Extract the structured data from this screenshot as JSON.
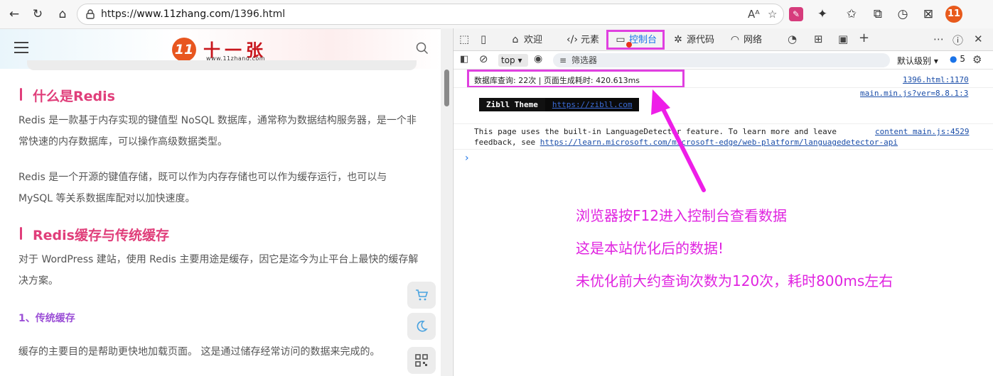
{
  "browser": {
    "url_prefix": "https://",
    "url_host": "www.11zhang.com",
    "url_path": "/1396.html",
    "read_aloud": "Aᴬ",
    "avatar_text": "11"
  },
  "site": {
    "logo_mark": "11",
    "logo_name": "十一张",
    "logo_sub": "www.11zhang.com"
  },
  "article": {
    "h2_1": "什么是Redis",
    "p1": "Redis 是一款基于内存实现的键值型 NoSQL 数据库，通常称为数据结构服务器，是一个非常快速的内存数据库，可以操作高级数据类型。",
    "p2": "Redis 是一个开源的键值存储，既可以作为内存存储也可以作为缓存运行，也可以与 MySQL 等关系数据库配对以加快速度。",
    "h2_2": "Redis缓存与传统缓存",
    "p3": "对于 WordPress 建站，使用 Redis 主要用途是缓存，因它是迄今为止平台上最快的缓存解决方案。",
    "h3_1": "1、传统缓存",
    "p4": "缓存的主要目的是帮助更快地加载页面。 这是通过储存经常访问的数据来完成的。"
  },
  "devtools": {
    "tabs": [
      {
        "label": "欢迎",
        "icon": "home-icon"
      },
      {
        "label": "元素",
        "icon": "code-icon"
      },
      {
        "label": "控制台",
        "icon": "console-icon"
      },
      {
        "label": "源代码",
        "icon": "bug-icon"
      },
      {
        "label": "网络",
        "icon": "wifi-icon"
      }
    ],
    "context": "top",
    "filter_placeholder": "筛选器",
    "level": "默认级别",
    "issues_count": "5",
    "logs": {
      "line1": "数据库查询: 22次 | 页面生成耗时: 420.613ms",
      "line1_src": "1396.html:1170",
      "line2_src": "main.min.js?ver=8.8.1:3",
      "badge_left": "Zibll Theme",
      "badge_right": "https://zibll.com",
      "line3a": "This page uses the built-in LanguageDetector feature. To learn more and leave",
      "line3b_prefix": "feedback, see ",
      "line3b_link": "https://learn.microsoft.com/microsoft-edge/web-platform/languagedetector-api",
      "line3_src": "content main.js:4529",
      "prompt": "›"
    },
    "annotations": [
      "浏览器按F12进入控制台查看数据",
      "这是本站优化后的数据!",
      "未优化前大约查询次数为120次，耗时800ms左右"
    ]
  },
  "colors": {
    "highlight": "#e040e0",
    "heading": "#e03e7a",
    "subheading": "#9b4fd6"
  }
}
